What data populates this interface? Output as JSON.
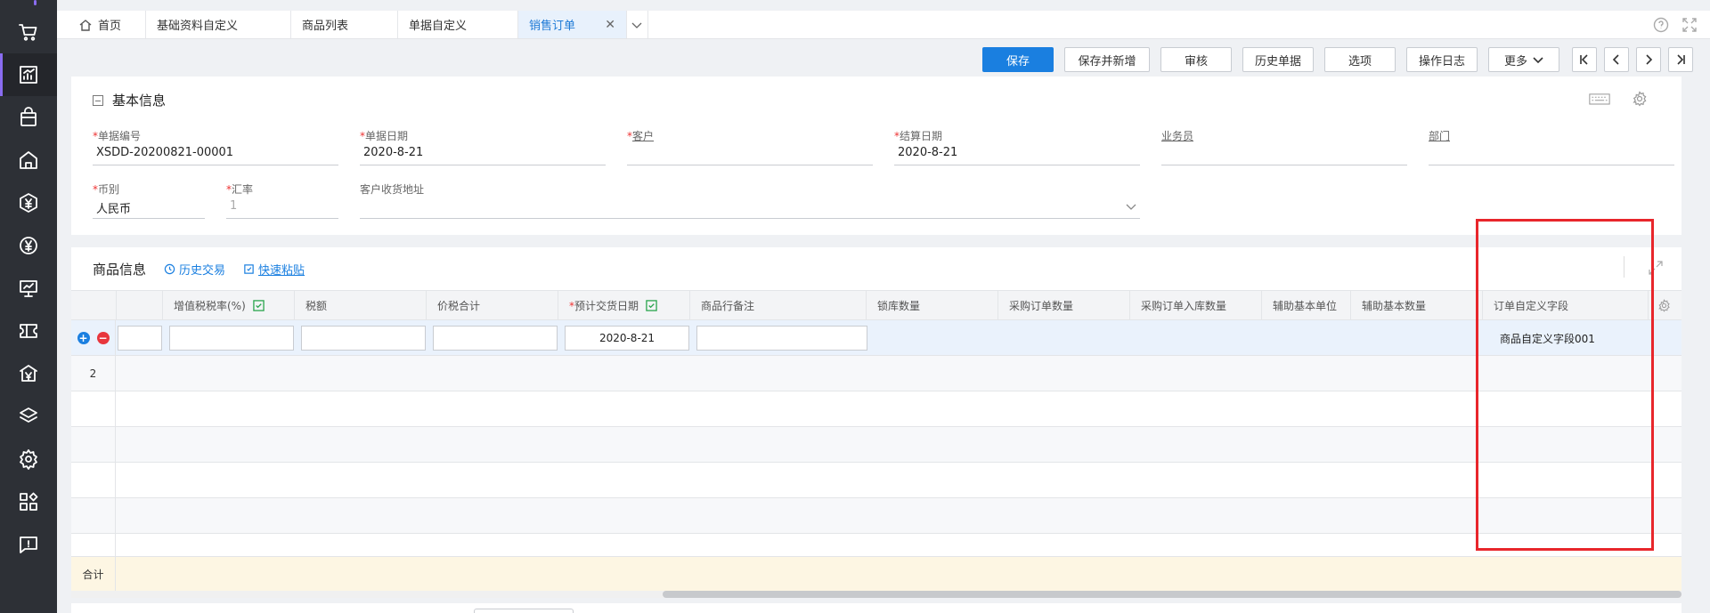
{
  "sidebar": {
    "items": [
      {
        "icon": "cart-icon"
      },
      {
        "icon": "report-icon",
        "active": true
      },
      {
        "icon": "bag-icon"
      },
      {
        "icon": "warehouse-icon"
      },
      {
        "icon": "finance-hexagon-icon"
      },
      {
        "icon": "yen-circle-icon"
      },
      {
        "icon": "presentation-icon"
      },
      {
        "icon": "ticket-icon"
      },
      {
        "icon": "bank-icon"
      },
      {
        "icon": "layers-icon"
      },
      {
        "icon": "gear-icon"
      },
      {
        "icon": "apps-icon"
      },
      {
        "icon": "feedback-icon"
      }
    ]
  },
  "tabs": {
    "home": "首页",
    "t2": "基础资料自定义",
    "t3": "商品列表",
    "t4": "单据自定义",
    "active": "销售订单"
  },
  "toolbar": {
    "save": "保存",
    "save_new": "保存并新增",
    "audit": "审核",
    "history_docs": "历史单据",
    "options": "选项",
    "log": "操作日志",
    "more": "更多"
  },
  "basic_info": {
    "title": "基本信息",
    "fields": {
      "doc_no_label": "单据编号",
      "doc_no": "XSDD-20200821-00001",
      "doc_date_label": "单据日期",
      "doc_date": "2020-8-21",
      "customer_label": "客户",
      "customer": "",
      "settle_date_label": "结算日期",
      "settle_date": "2020-8-21",
      "salesman_label": "业务员",
      "salesman": "",
      "department_label": "部门",
      "department": "",
      "currency_label": "币别",
      "currency": "人民币",
      "rate_label": "汇率",
      "rate": "1",
      "address_label": "客户收货地址",
      "address": ""
    }
  },
  "goods": {
    "title": "商品信息",
    "history_trade": "历史交易",
    "quick_paste": "快速粘贴",
    "columns": {
      "vat_rate": "增值税税率(%)",
      "tax": "税额",
      "total_with_tax": "价税合计",
      "expected_date": "预计交货日期",
      "line_note": "商品行备注",
      "stock_qty": "锁库数量",
      "po_qty": "采购订单数量",
      "po_in_qty": "采购订单入库数量",
      "aux_unit": "辅助基本单位",
      "aux_qty": "辅助基本数量",
      "order_custom": "订单自定义字段"
    },
    "rows": [
      {
        "expected_date": "2020-8-21",
        "order_custom": "商品自定义字段001"
      },
      {
        "num": "2"
      }
    ],
    "total_label": "合计"
  }
}
